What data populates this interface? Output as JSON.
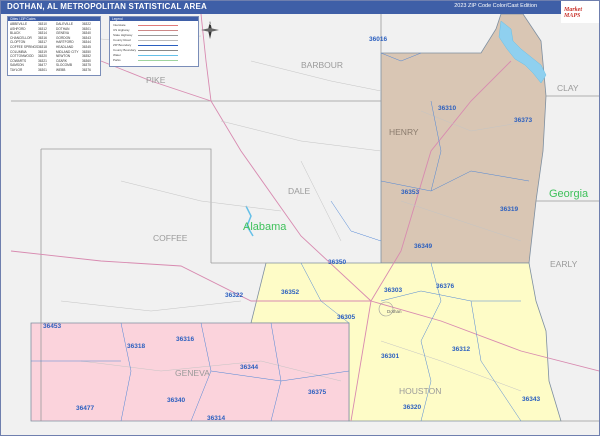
{
  "title": "DOTHAN, AL METROPOLITAN STATISTICAL AREA",
  "edition": "2023 ZIP Code Color/Cast Edition",
  "publisher_logo": "Market MAPS",
  "legend": {
    "header": "Cities / ZIP Codes",
    "rows": [
      [
        "ABBEVILLE",
        "36310",
        "DALEVILLE",
        "36322"
      ],
      [
        "ASHFORD",
        "36312",
        "DOTHAN",
        "36301"
      ],
      [
        "BLACK",
        "36314",
        "GENEVA",
        "36340"
      ],
      [
        "CHANCELLOR",
        "36316",
        "GORDON",
        "36343"
      ],
      [
        "CLOPTON",
        "36317",
        "HARTFORD",
        "36344"
      ],
      [
        "COFFEE SPRINGS",
        "36318",
        "HEADLAND",
        "36345"
      ],
      [
        "COLUMBIA",
        "36319",
        "MIDLAND CITY",
        "36350"
      ],
      [
        "COTTONWOOD",
        "36320",
        "NEWTON",
        "36352"
      ],
      [
        "COWARTS",
        "36321",
        "OZARK",
        "36360"
      ],
      [
        "SAMSON",
        "36477",
        "SLOCOMB",
        "36375"
      ],
      [
        "TAYLOR",
        "36301",
        "WEBB",
        "36376"
      ]
    ]
  },
  "key": {
    "header": "Legend",
    "items": [
      {
        "label": "Interstate",
        "color": "#e07a7a"
      },
      {
        "label": "US Highway",
        "color": "#c88"
      },
      {
        "label": "State Highway",
        "color": "#999"
      },
      {
        "label": "County Road",
        "color": "#bbb"
      },
      {
        "label": "ZIP Boundary",
        "color": "#2b5fbf"
      },
      {
        "label": "County Boundary",
        "color": "#888"
      },
      {
        "label": "Water",
        "color": "#66c0e8"
      },
      {
        "label": "Parks",
        "color": "#9fd49f"
      }
    ]
  },
  "compass_label": "N",
  "counties": {
    "pike": "PIKE",
    "barbour": "BARBOUR",
    "clay": "CLAY",
    "henry": "HENRY",
    "dale": "DALE",
    "coffee": "COFFEE",
    "early": "EARLY",
    "geneva": "GENEVA",
    "houston": "HOUSTON"
  },
  "states": {
    "alabama": "Alabama",
    "georgia": "Georgia"
  },
  "city": "Dothan",
  "zips": {
    "z36016": "36016",
    "z36310": "36310",
    "z36373": "36373",
    "z36353": "36353",
    "z36319": "36319",
    "z36349": "36349",
    "z36350": "36350",
    "z36322": "36322",
    "z36352": "36352",
    "z36303": "36303",
    "z36376": "36376",
    "z36305": "36305",
    "z36453": "36453",
    "z36318": "36318",
    "z36316": "36316",
    "z36344": "36344",
    "z36301": "36301",
    "z36312": "36312",
    "z36375": "36375",
    "z36477": "36477",
    "z36340": "36340",
    "z36314": "36314",
    "z36320": "36320",
    "z36343": "36343"
  },
  "colors": {
    "title_bar": "#3f5fa7",
    "henry_fill": "#d9c6b4",
    "houston_fill": "#fefcc7",
    "geneva_fill": "#fbd3dc",
    "background": "#f1f1f1",
    "state_label": "#3fc15b",
    "zip_label": "#2b5fbf"
  }
}
